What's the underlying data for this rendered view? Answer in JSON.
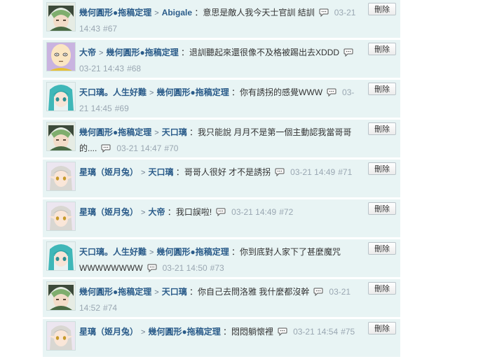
{
  "ui": {
    "delete_label": "刪除"
  },
  "comments": [
    {
      "avatar": "green-hair-avatar",
      "author": "幾何圓形●拖稿定理",
      "target": "Abigale",
      "text": "意思是敵人我今天士官訓 結訓",
      "time": "03-21 14:43",
      "no": "#67"
    },
    {
      "avatar": "bald-hero-avatar",
      "author": "大帝",
      "target": "幾何圓形●拖稿定理",
      "text": "退訓聽起來還很像不及格被踢出去XDDD",
      "time": "03-21 14:43",
      "no": "#68"
    },
    {
      "avatar": "teal-hair-avatar",
      "author": "天口璃。人生好難",
      "target": "幾何圓形●拖稿定理",
      "text": "你有誘拐的感覺WWW",
      "time": "03-21 14:45",
      "no": "#69"
    },
    {
      "avatar": "green-hair-avatar",
      "author": "幾何圓形●拖稿定理",
      "target": "天口璃",
      "text": "我只能說 月月不是第一個主動認我當哥哥的....",
      "time": "03-21 14:47",
      "no": "#70"
    },
    {
      "avatar": "elf-avatar",
      "author": "星璃（姬月兔）",
      "target": "天口璃",
      "text": "哥哥人很好 才不是誘拐",
      "time": "03-21 14:49",
      "no": "#71"
    },
    {
      "avatar": "elf-avatar",
      "author": "星璃（姬月兔）",
      "target": "大帝",
      "text": "我口誤啦!",
      "time": "03-21 14:49",
      "no": "#72"
    },
    {
      "avatar": "teal-hair-avatar",
      "author": "天口璃。人生好難",
      "target": "幾何圓形●拖稿定理",
      "text": "你到底對人家下了甚麼魔咒WWWWWWWW",
      "time": "03-21 14:50",
      "no": "#73"
    },
    {
      "avatar": "green-hair-avatar",
      "author": "幾何圓形●拖稿定理",
      "target": "天口璃",
      "text": "你自己去問洛雅 我什麼都沒幹",
      "time": "03-21 14:52",
      "no": "#74"
    },
    {
      "avatar": "elf-avatar",
      "author": "星璃（姬月兔）",
      "target": "幾何圓形●拖稿定理",
      "text": "悶悶躺懷裡",
      "time": "03-21 14:54",
      "no": "#75"
    }
  ]
}
